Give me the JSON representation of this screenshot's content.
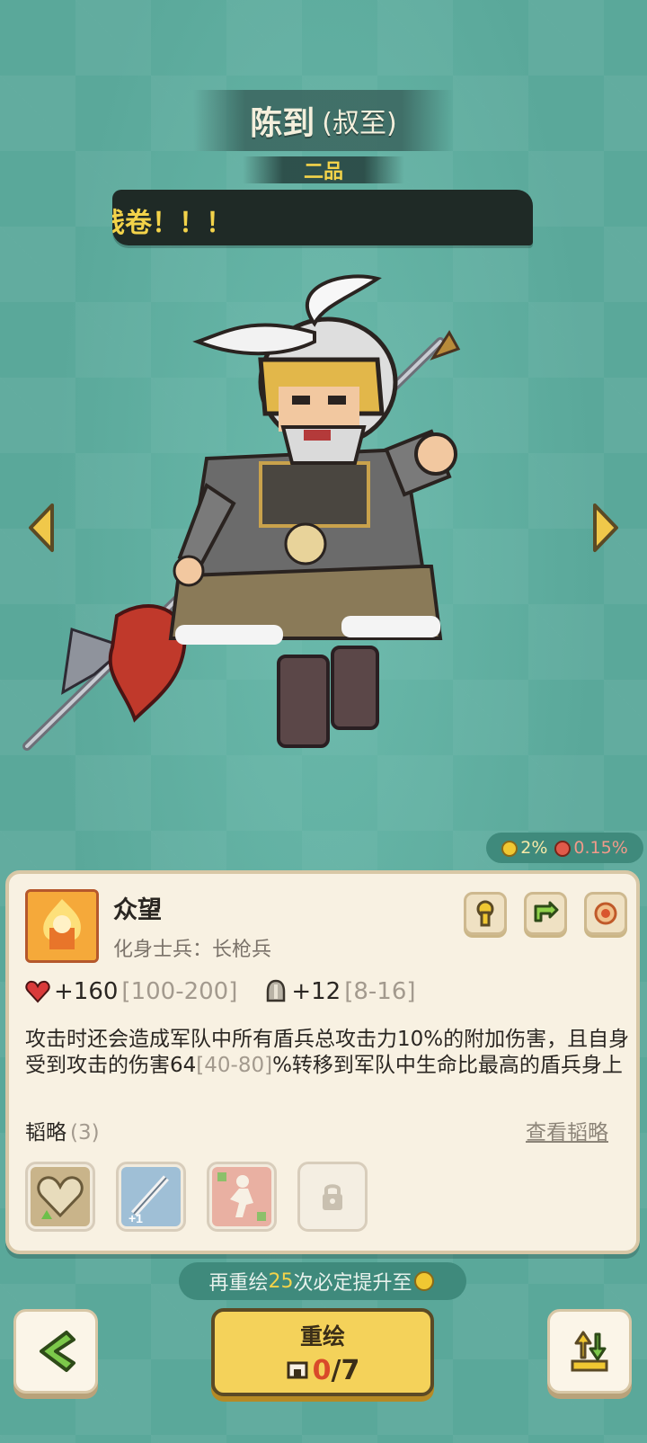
{
  "header": {
    "name": "陈到",
    "courtesy_name": "(叔至)",
    "rank": "二品",
    "speech": "钱卷！！！"
  },
  "navigation": {
    "prev_icon": "chevron-left-icon",
    "next_icon": "chevron-right-icon"
  },
  "odds": {
    "gold_rate": "2%",
    "red_rate": "0.15%",
    "gold_color": "#f0c832",
    "red_color": "#e05a4a"
  },
  "skill": {
    "name": "众望",
    "subtitle": "化身士兵：长枪兵",
    "hp_bonus": "+160",
    "hp_range": "[100-200]",
    "def_bonus": "+12",
    "def_range": "[8-16]",
    "desc_part1": "攻击时还会造成军队中所有盾兵总攻击力10%的附加伤害，且自身受到攻击的伤害64",
    "desc_range": "[40-80]",
    "desc_part2": "%转移到军队中生命比最高的盾兵身上",
    "action_icons": [
      "keyhole-icon",
      "swap-arrow-icon",
      "target-coin-icon"
    ]
  },
  "strategies": {
    "label": "韬略",
    "count": "(3)",
    "view_link": "查看韬略",
    "tiles": [
      "heart-up-icon",
      "sword-plus-icon",
      "running-soldier-icon",
      "lock-icon"
    ]
  },
  "footer": {
    "hint_prefix": "再重绘",
    "hint_count": "25",
    "hint_suffix": "次必定提升至",
    "redraw_label": "重绘",
    "redraw_used": "0",
    "redraw_total": "/7",
    "back_icon": "back-chevron-icon",
    "upgrade_icon": "upgrade-arrows-icon"
  }
}
